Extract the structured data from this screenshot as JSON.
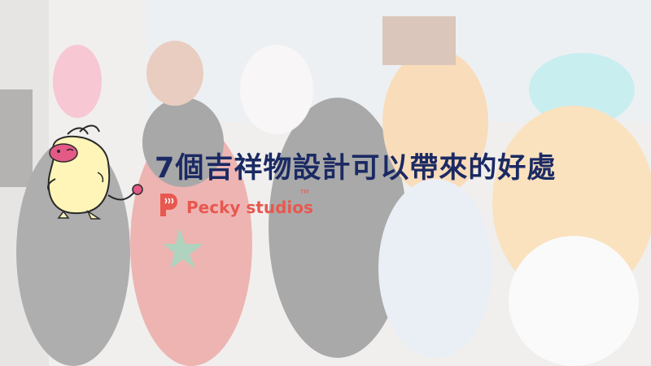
{
  "title": "7個吉祥物設計可以帶來的好處",
  "brand": {
    "name": "Pecky studios",
    "trademark": "TM",
    "logo_icon": "pecky-p-logo-icon"
  },
  "illustration": "yellow-creature-mascot",
  "background_photo": "mascot-costume-gathering-photo",
  "colors": {
    "title": "#1b2a63",
    "brand": "#e8584f",
    "mascot_body": "#fff5b8",
    "mascot_face": "#e45a86"
  }
}
